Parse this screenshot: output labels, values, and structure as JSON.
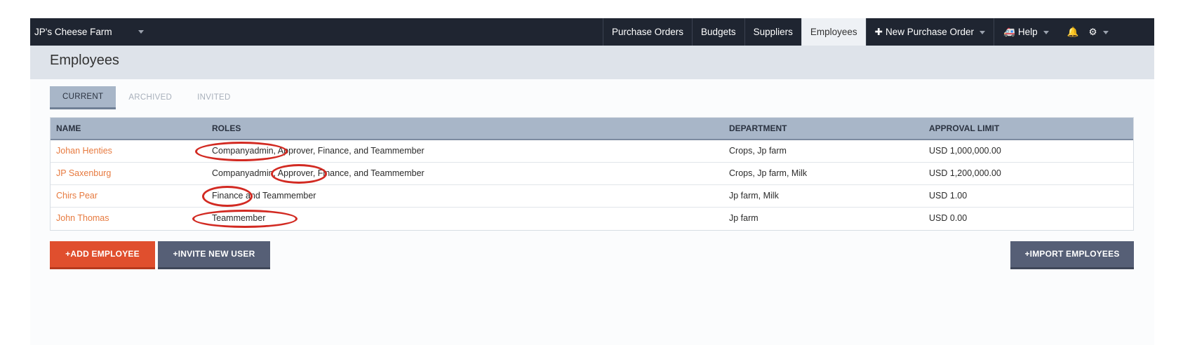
{
  "topbar": {
    "brand": "JP's Cheese Farm",
    "nav": [
      "Purchase Orders",
      "Budgets",
      "Suppliers",
      "Employees"
    ],
    "new_po": "New Purchase Order",
    "help": "Help"
  },
  "page": {
    "title": "Employees"
  },
  "tabs": [
    "CURRENT",
    "ARCHIVED",
    "INVITED"
  ],
  "table": {
    "headers": [
      "NAME",
      "ROLES",
      "DEPARTMENT",
      "APPROVAL LIMIT"
    ],
    "rows": [
      {
        "name": "Johan Henties",
        "roles": "Companyadmin, Approver, Finance, and Teammember",
        "department": "Crops, Jp farm",
        "limit": "USD 1,000,000.00"
      },
      {
        "name": "JP Saxenburg",
        "roles": "Companyadmin, Approver, Finance, and Teammember",
        "department": "Crops, Jp farm, Milk",
        "limit": "USD 1,200,000.00"
      },
      {
        "name": "Chirs Pear",
        "roles": "Finance and Teammember",
        "department": "Jp farm, Milk",
        "limit": "USD 1.00"
      },
      {
        "name": "John Thomas",
        "roles": "Teammember",
        "department": "Jp farm",
        "limit": "USD 0.00"
      }
    ]
  },
  "buttons": {
    "add": "ADD EMPLOYEE",
    "invite": "INVITE NEW USER",
    "import": "IMPORT EMPLOYEES"
  },
  "icons": {
    "plus": "plus-icon",
    "help": "ambulance-icon",
    "bell": "bell-icon",
    "gear": "gear-icon"
  },
  "colors": {
    "topbar": "#1f2531",
    "accent_orange": "#e04f2e",
    "link": "#e77a3f",
    "button_slate": "#565f76",
    "annotation_red": "#d22a22"
  }
}
